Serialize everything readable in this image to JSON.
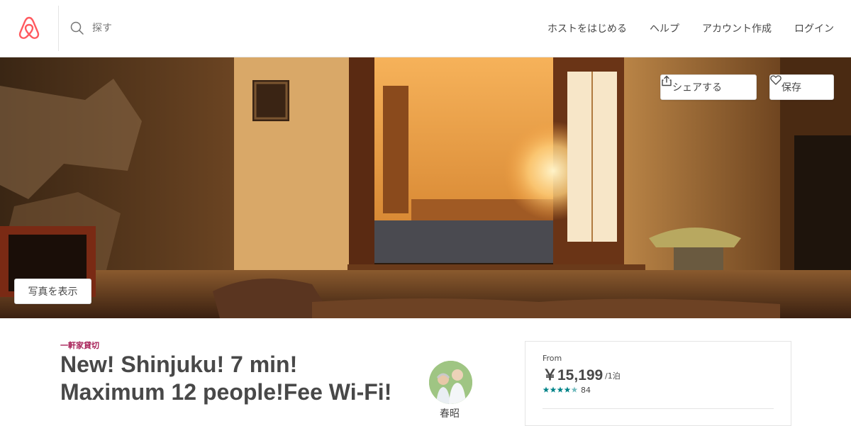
{
  "header": {
    "search_placeholder": "探す",
    "nav": [
      "ホストをはじめる",
      "ヘルプ",
      "アカウント作成",
      "ログイン"
    ]
  },
  "hero": {
    "share_label": "シェアする",
    "save_label": "保存",
    "show_photos_label": "写真を表示"
  },
  "listing": {
    "badge": "一軒家貸切",
    "title": "New! Shinjuku! 7 min! Maximum 12 people!Fee Wi-Fi!",
    "host_name": "春昭"
  },
  "booking": {
    "from_label": "From",
    "price": "￥15,199",
    "per_night": "/1泊",
    "rating": 4.5,
    "review_count": "84"
  },
  "colors": {
    "brand": "#ff5a5f",
    "badge": "#a61d55",
    "star": "#008489"
  }
}
